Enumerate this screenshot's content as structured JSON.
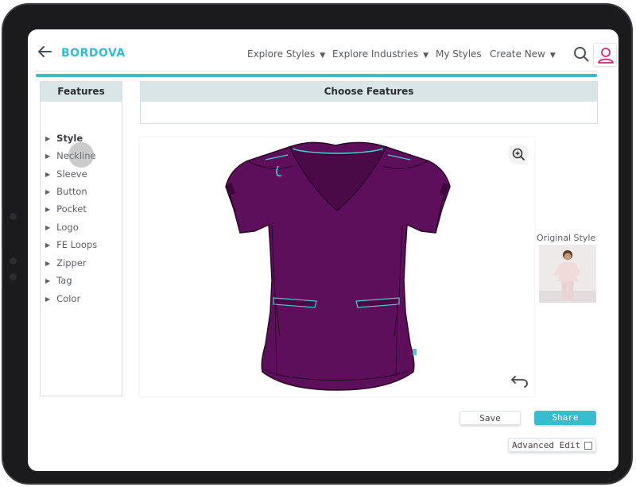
{
  "app": {
    "brand": "BORDOVA",
    "accent_color": "#38bcd0",
    "garment_color": "#5e0f5b"
  },
  "header": {
    "back_icon": "arrow-left-icon",
    "nav": [
      {
        "label": "Explore Styles",
        "has_dropdown": true
      },
      {
        "label": "Explore Industries",
        "has_dropdown": true
      },
      {
        "label": "My Styles",
        "has_dropdown": false
      },
      {
        "label": "Create New",
        "has_dropdown": true
      }
    ],
    "search_icon": "search-icon",
    "user_icon": "user-icon"
  },
  "features_panel": {
    "title": "Features",
    "items": [
      {
        "label": "Style",
        "active": true
      },
      {
        "label": "Neckline",
        "active": false
      },
      {
        "label": "Sleeve",
        "active": false
      },
      {
        "label": "Button",
        "active": false
      },
      {
        "label": "Pocket",
        "active": false
      },
      {
        "label": "Logo",
        "active": false
      },
      {
        "label": "FE Loops",
        "active": false
      },
      {
        "label": "Zipper",
        "active": false
      },
      {
        "label": "Tag",
        "active": false
      },
      {
        "label": "Color",
        "active": false
      }
    ]
  },
  "choose_panel": {
    "title": "Choose Features"
  },
  "canvas": {
    "zoom_icon": "zoom-in-icon",
    "undo_icon": "undo-icon"
  },
  "original": {
    "label": "Original Style"
  },
  "actions": {
    "save": "Save",
    "share": "Share",
    "advanced_edit": "Advanced Edit"
  }
}
